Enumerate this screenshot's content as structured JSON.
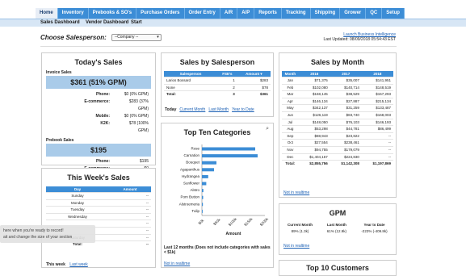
{
  "nav": {
    "tabs": [
      "Home",
      "Inventory",
      "Prebooks & SO's",
      "Purchase Orders",
      "Order Entry",
      "A/R",
      "A/P",
      "Reports",
      "Tracking",
      "Shipping",
      "Grower",
      "QC",
      "Setup"
    ],
    "subtabs": [
      "Sales Dashboard",
      "Vendor Dashboard",
      "Start"
    ]
  },
  "salesperson": {
    "label": "Choose Salesperson:",
    "selected": "--Company --"
  },
  "top_links": {
    "bi_link": "Launch Business Intelligence",
    "last_updated": "Last Updated: 08/09/2018 05:54:43 EST"
  },
  "todays_sales": {
    "title": "Today's Sales",
    "invoice_label": "Invoice Sales",
    "invoice_total": "$361 (51% GPM)",
    "rows": [
      {
        "k": "Phone:",
        "v": "$0 (0% GPM)"
      },
      {
        "k": "E-commerce:",
        "v": "$283 (37% GPM)"
      },
      {
        "k": "Mobile:",
        "v": "$0 (0% GPM)"
      },
      {
        "k": "K2K:",
        "v": "$78 (100% GPM)"
      }
    ],
    "prebook_label": "Prebook Sales",
    "prebook_total": "$195",
    "prebook_rows": [
      {
        "k": "Phone:",
        "v": "$195"
      },
      {
        "k": "E-commerce:",
        "v": "$0"
      }
    ]
  },
  "weeks_sales": {
    "title": "This Week's Sales",
    "headers": [
      "Day",
      "Amount"
    ],
    "rows": [
      {
        "day": "Sunday",
        "amount": "--"
      },
      {
        "day": "Monday",
        "amount": "--"
      },
      {
        "day": "Tuesday",
        "amount": "--"
      },
      {
        "day": "Wednesday",
        "amount": "--"
      },
      {
        "day": "",
        "amount": "--"
      },
      {
        "day": "",
        "amount": "--"
      },
      {
        "day": "Saturday",
        "amount": "--"
      },
      {
        "day": "Total:",
        "amount": "--"
      }
    ],
    "footer": "This week",
    "footer_link": "Last week"
  },
  "by_salesperson": {
    "title": "Sales by Salesperson",
    "headers": [
      "Salesperson",
      "FSE's",
      "Amount"
    ],
    "rows": [
      {
        "name": "Larios Bossard",
        "fse": "1",
        "amt": "$283"
      },
      {
        "name": "None",
        "fse": "2",
        "amt": "$78"
      },
      {
        "name": "Total:",
        "fse": "3",
        "amt": "$361"
      }
    ],
    "footer": [
      "Today",
      "Current Month",
      "Last Month",
      "Year to Date"
    ]
  },
  "top_categories": {
    "title": "Top Ten Categories",
    "note": "Last 12 months (Does not include categories with sales < $1k)",
    "link": "Not in realtime",
    "xlabel": "Amount"
  },
  "chart_data": {
    "type": "bar",
    "orientation": "horizontal",
    "categories": [
      "Rose",
      "Carnation",
      "Bouquet",
      "Agapanthus",
      "Hydrangea",
      "Sunflower",
      "Alstro",
      "Pom Button",
      "Alstroemeria",
      "Tulip"
    ],
    "values": [
      2200,
      2300,
      600,
      500,
      260,
      180,
      60,
      50,
      40,
      30
    ],
    "xlabel": "Amount",
    "xticks": [
      "$0k",
      "$50k",
      "$100k",
      "$150k",
      "$200k"
    ],
    "xlim": [
      0,
      2600
    ]
  },
  "by_month": {
    "title": "Sales by Month",
    "headers": [
      "Month",
      "2016",
      "2017",
      "2018"
    ],
    "rows": [
      [
        "Jan",
        "$71,375",
        "$35,007",
        "$141,951"
      ],
      [
        "Feb",
        "$102,080",
        "$140,714",
        "$148,519"
      ],
      [
        "Mar",
        "$168,145",
        "$38,529",
        "$157,293"
      ],
      [
        "Apr",
        "$146,134",
        "$27,887",
        "$215,134"
      ],
      [
        "May",
        "$342,137",
        "$31,259",
        "$133,487"
      ],
      [
        "Jun",
        "$126,119",
        "$83,740",
        "$168,003"
      ],
      [
        "Jul",
        "$148,050",
        "$76,103",
        "$146,193"
      ],
      [
        "Aug",
        "$53,298",
        "$44,781",
        "$86,499"
      ],
      [
        "Sep",
        "$88,943",
        "$23,822",
        "--"
      ],
      [
        "Oct",
        "$27,554",
        "$238,461",
        "--"
      ],
      [
        "Nov",
        "$94,755",
        "$179,079",
        "--"
      ],
      [
        "Dec",
        "$1,404,167",
        "$224,830",
        "--"
      ],
      [
        "Total:",
        "$2,855,756",
        "$1,142,308",
        "$1,197,869"
      ]
    ],
    "link": "Not in realtime"
  },
  "gpm": {
    "title": "GPM",
    "headers": [
      "Current Month",
      "Last Month",
      "Year to Date"
    ],
    "values": [
      "89% (1.3k)",
      "61% (12.9k)",
      "-223% (-409.8k)"
    ],
    "link": "Not in realtime"
  },
  "top10_customers": {
    "title": "Top 10 Customers"
  },
  "tooltip": {
    "line1": "here when you're ready to record!",
    "line2": "ait and change the size of your section"
  },
  "colors": {
    "accent": "#3c8dd6",
    "highlight": "#a9cbe9",
    "link": "#1a5fb4"
  }
}
